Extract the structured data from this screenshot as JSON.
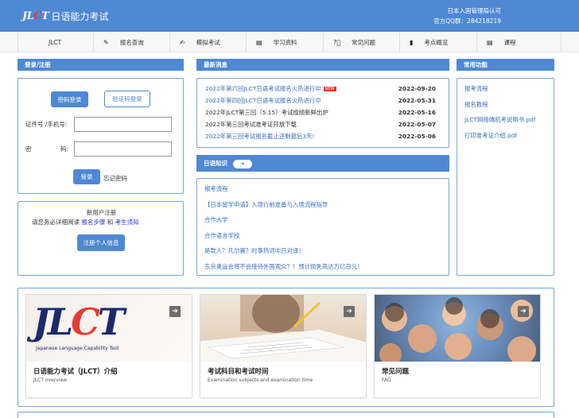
{
  "header": {
    "logo_mark_a": "JL",
    "logo_mark_c": "C",
    "logo_mark_t": "T",
    "logo_text": "日语能力考试",
    "right_line1": "日本入国管理局认可",
    "right_line2": "官方QQ群：284218219",
    "bg_color": "#4f88d3"
  },
  "nav": {
    "items": [
      {
        "icon": "",
        "label": "JLCT"
      },
      {
        "icon": "pencil-icon",
        "label": "报名查询"
      },
      {
        "icon": "edit-icon",
        "label": "模拟考试"
      },
      {
        "icon": "document-icon",
        "label": "学习资料"
      },
      {
        "icon": "question-icon",
        "label": "常见问题"
      },
      {
        "icon": "bookmark-icon",
        "label": "考点概览"
      },
      {
        "icon": "book-icon",
        "label": "课程"
      }
    ]
  },
  "login": {
    "header": "登录/注册",
    "tab_password": "密码登录",
    "tab_code": "验证码登录",
    "id_label": "证件号 /手机号:",
    "id_value": "",
    "pwd_label_a": "密",
    "pwd_label_b": "码:",
    "pwd_value": "",
    "login_button": "登录",
    "forgot": "忘记密码"
  },
  "register": {
    "title": "新用户注册",
    "note_prefix": "请您务必详细阅读",
    "link_steps": "报名步骤",
    "and": "和",
    "link_notice": "考生须知",
    "button": "注册个人信息"
  },
  "news": {
    "header": "最新消息",
    "items": [
      {
        "title": "2022年第六回JLCT日语考试报名火热进行中",
        "date": "2022-09-20",
        "new": "NEW",
        "dark": false
      },
      {
        "title": "2022年第四回JLCT日语考试报名火热进行中",
        "date": "2022-05-31",
        "new": "",
        "dark": false
      },
      {
        "title": "2022年JLCT第三回（5.15）考试成绩新鲜出炉",
        "date": "2022-05-16",
        "new": "",
        "dark": true
      },
      {
        "title": "2022年第三回考试准考证开放下载",
        "date": "2022-05-07",
        "new": "",
        "dark": true
      },
      {
        "title": "2022年第三回考试报名截止还剩最后3天!",
        "date": "2022-05-06",
        "new": "",
        "dark": false
      }
    ]
  },
  "knowledge": {
    "header": "日语知识",
    "items": [
      "报考流程",
      "【日本留学申请】入境行前准备与入境流程指导",
      "合作大学",
      "合作语言学校",
      "是款人？凡尔赛？时事热词中日对译！",
      "东京奥运会将不会接待外国观众？！预计损失高达万亿日元！"
    ]
  },
  "common": {
    "header": "常用功能",
    "items": [
      "报考流程",
      "报名教程",
      "JLCT网络端机考说明书.pdf",
      "打印准考证介绍.pdf"
    ]
  },
  "cards": [
    {
      "title": "日语能力考试（JLCT）介绍",
      "sub": "JLCT overview",
      "img_caption": "Japanese Language Capability Test",
      "img_mark_a": "JL",
      "img_mark_c": "C",
      "img_mark_t": "T"
    },
    {
      "title": "考试科目和考试时间",
      "sub": "Examination subjects and examination time"
    },
    {
      "title": "常见问题",
      "sub": "FAQ"
    }
  ],
  "arrow_glyph": "➜"
}
